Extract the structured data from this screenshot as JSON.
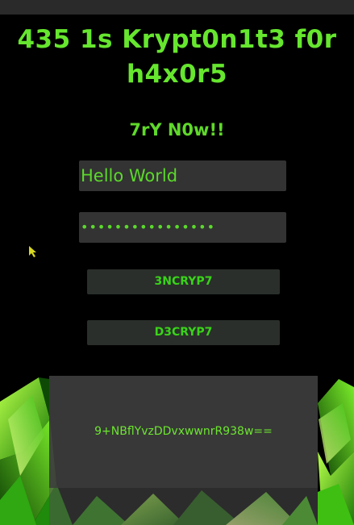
{
  "app": {
    "title": "435 1s Krypt0n1t3 f0r h4x0r5",
    "subtitle": "7rY N0w!!"
  },
  "form": {
    "plaintext_value": "Hello World",
    "password_mask": "••••••••••••••••"
  },
  "actions": {
    "encrypt_label": "3NCRYP7",
    "decrypt_label": "D3CRYP7"
  },
  "output": {
    "result_text": "9+NBflYvzDDvxwwnrR938w=="
  },
  "colors": {
    "accent_green": "#66e62e",
    "background": "#000000",
    "field_background": "#333333",
    "button_background": "#2a2f2b"
  },
  "icons": {
    "cursor": "mouse-pointer-icon",
    "background": "green-crystal-image"
  }
}
